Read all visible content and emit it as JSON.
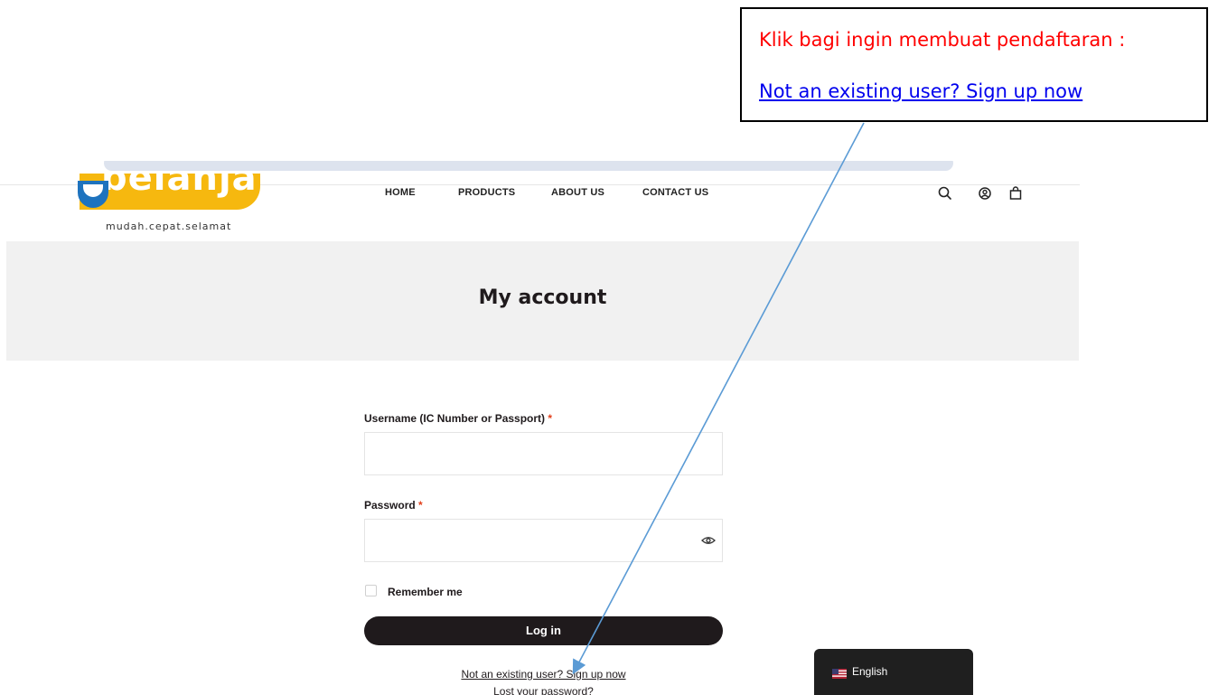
{
  "annotation": {
    "title": "Klik bagi ingin membuat pendaftaran :",
    "link": "Not an existing user? Sign up now",
    "title_color": "#ff0000",
    "link_color": "#0000ee",
    "arrow_color": "#5b9bd5"
  },
  "header": {
    "logo_text": "belanja",
    "tagline": "mudah.cepat.selamat",
    "nav": [
      "HOME",
      "PRODUCTS",
      "ABOUT US",
      "CONTACT US"
    ],
    "icons": [
      "search-icon",
      "account-icon",
      "cart-icon"
    ],
    "logo_color": "#f6b80f",
    "logo_accent": "#1e73be"
  },
  "page": {
    "title": "My account"
  },
  "login_form": {
    "username_label": "Username (IC Number or Passport)",
    "password_label": "Password",
    "required_mark": "*",
    "username_value": "",
    "password_value": "",
    "remember_label": "Remember me",
    "remember_checked": false,
    "submit_label": "Log in",
    "signup_link": "Not an existing user? Sign up now",
    "lost_password_link": "Lost your password?"
  },
  "language_switcher": {
    "label": "English",
    "flag": "us-flag-icon"
  }
}
